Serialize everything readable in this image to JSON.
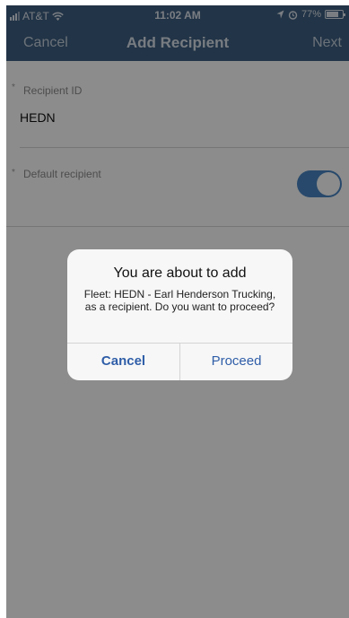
{
  "status_bar": {
    "carrier": "AT&T",
    "time": "11:02 AM",
    "battery": "77%",
    "battery_level": 0.77
  },
  "nav": {
    "cancel_label": "Cancel",
    "title": "Add Recipient",
    "next_label": "Next"
  },
  "form": {
    "recipient_id_label": "Recipient ID",
    "recipient_id_value": "HEDN",
    "default_recipient_label": "Default recipient",
    "default_recipient_on": true,
    "required_marker": "*"
  },
  "alert": {
    "title": "You are about to add",
    "message": "Fleet: HEDN - Earl Henderson Trucking, as a recipient. Do you want to proceed?",
    "cancel_label": "Cancel",
    "proceed_label": "Proceed"
  },
  "colors": {
    "nav_bar": "#3f5f82",
    "toggle_on": "#4a86c4",
    "alert_button": "#2f5ea8"
  }
}
